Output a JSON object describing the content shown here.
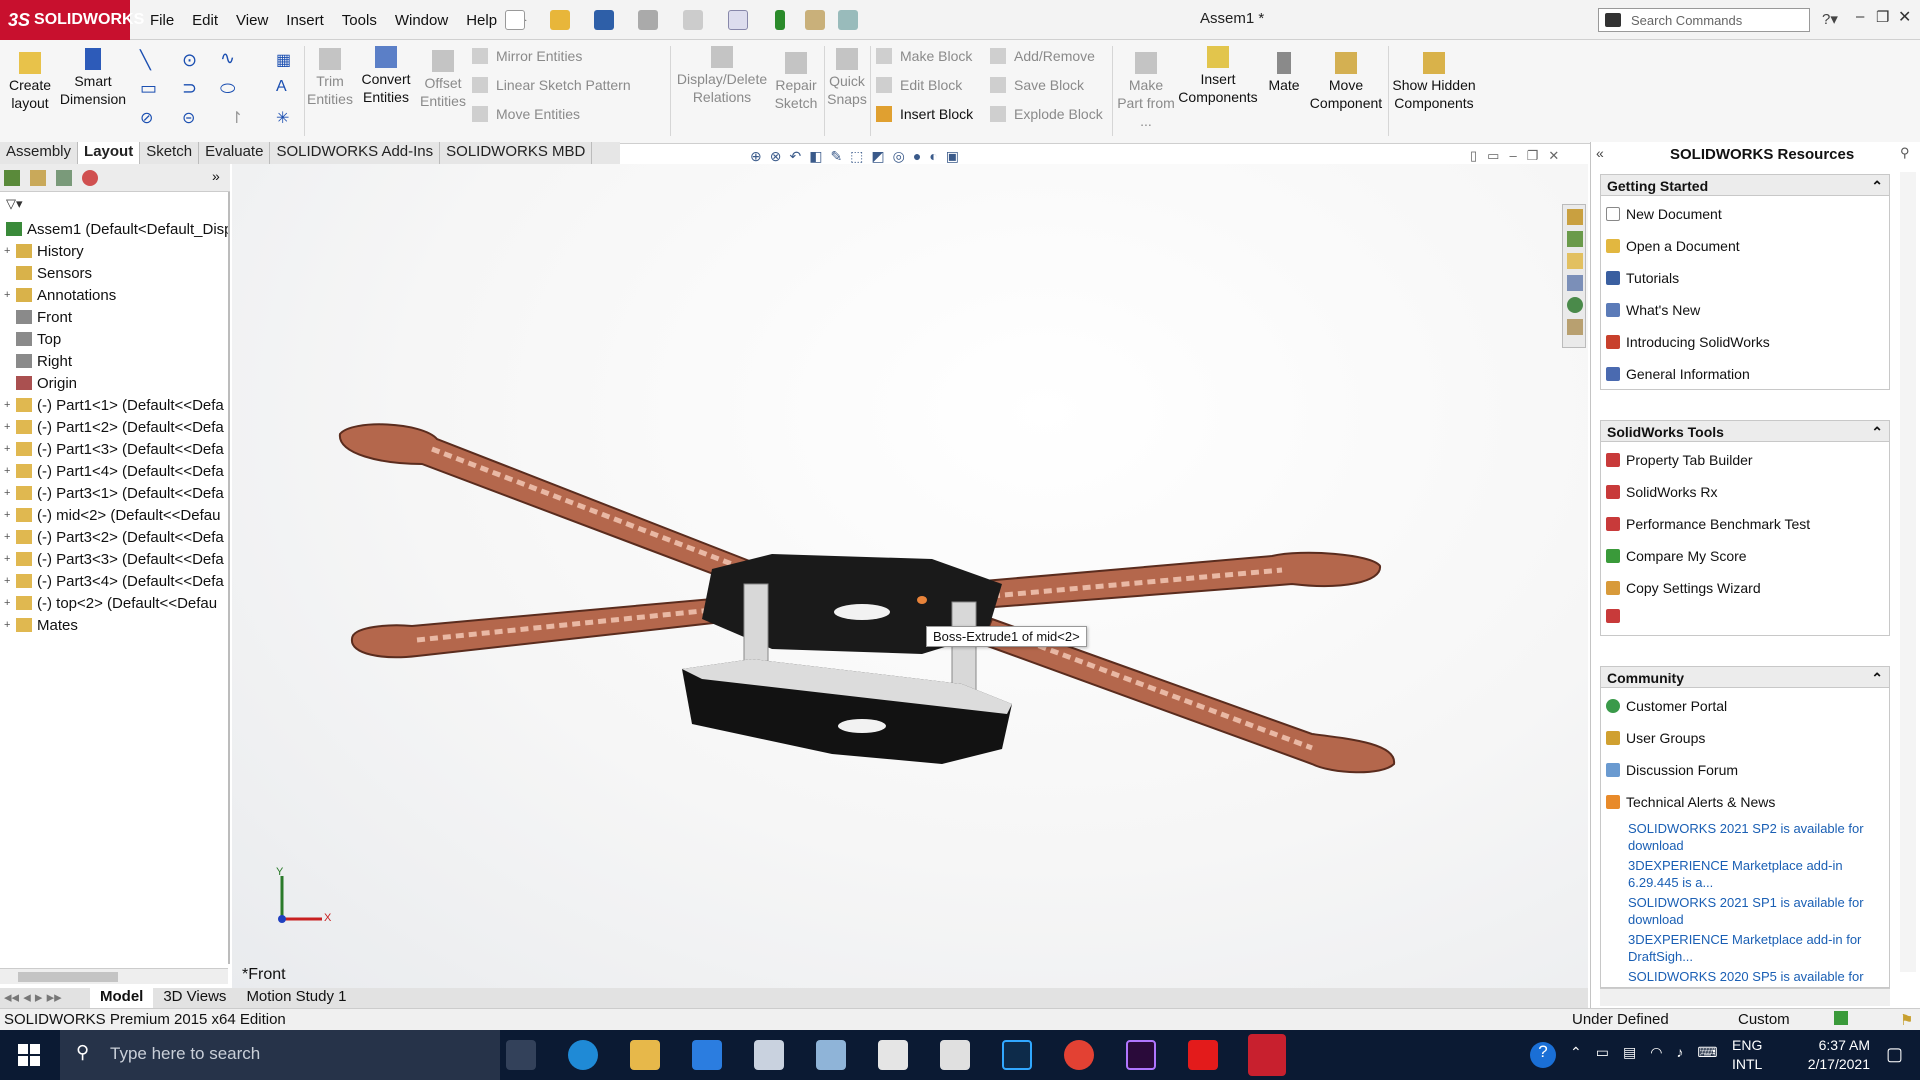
{
  "app": {
    "brand": "SOLIDWORKS",
    "doc_title": "Assem1 *"
  },
  "menu": [
    "File",
    "Edit",
    "View",
    "Insert",
    "Tools",
    "Window",
    "Help"
  ],
  "search": {
    "placeholder": "Search Commands"
  },
  "ribbon": {
    "create_layout": "Create layout",
    "smart_dimension": "Smart Dimension",
    "trim_entities": "Trim Entities",
    "convert_entities": "Convert Entities",
    "offset_entities": "Offset Entities",
    "mirror_entities": "Mirror Entities",
    "linear_sketch_pattern": "Linear Sketch Pattern",
    "move_entities": "Move Entities",
    "display_delete_relations": "Display/Delete Relations",
    "repair_sketch": "Repair Sketch",
    "quick_snaps": "Quick Snaps",
    "make_block": "Make Block",
    "edit_block": "Edit Block",
    "insert_block": "Insert Block",
    "add_remove": "Add/Remove",
    "save_block": "Save Block",
    "explode_block": "Explode Block",
    "make_part_from": "Make Part from ...",
    "insert_components": "Insert Components",
    "mate": "Mate",
    "move_component": "Move Component",
    "show_hidden_components": "Show Hidden Components"
  },
  "tabs": [
    "Assembly",
    "Layout",
    "Sketch",
    "Evaluate",
    "SOLIDWORKS Add-Ins",
    "SOLIDWORKS MBD"
  ],
  "tree": [
    {
      "label": "Assem1  (Default<Default_Disp",
      "expand": ""
    },
    {
      "label": "History",
      "expand": "+"
    },
    {
      "label": "Sensors",
      "expand": ""
    },
    {
      "label": "Annotations",
      "expand": "+"
    },
    {
      "label": "Front",
      "expand": ""
    },
    {
      "label": "Top",
      "expand": ""
    },
    {
      "label": "Right",
      "expand": ""
    },
    {
      "label": "Origin",
      "expand": ""
    },
    {
      "label": "(-) Part1<1> (Default<<Defa",
      "expand": "+"
    },
    {
      "label": "(-) Part1<2> (Default<<Defa",
      "expand": "+"
    },
    {
      "label": "(-) Part1<3> (Default<<Defa",
      "expand": "+"
    },
    {
      "label": "(-) Part1<4> (Default<<Defa",
      "expand": "+"
    },
    {
      "label": "(-) Part3<1> (Default<<Defa",
      "expand": "+"
    },
    {
      "label": "(-) mid<2> (Default<<Defau",
      "expand": "+"
    },
    {
      "label": "(-) Part3<2> (Default<<Defa",
      "expand": "+"
    },
    {
      "label": "(-) Part3<3> (Default<<Defa",
      "expand": "+"
    },
    {
      "label": "(-) Part3<4> (Default<<Defa",
      "expand": "+"
    },
    {
      "label": "(-) top<2> (Default<<Defau",
      "expand": "+"
    },
    {
      "label": "Mates",
      "expand": "+"
    }
  ],
  "viewport": {
    "tooltip": "Boss-Extrude1 of mid<2>",
    "view_label": "*Front",
    "axis_x": "X",
    "axis_y": "Y"
  },
  "resources": {
    "title": "SOLIDWORKS Resources",
    "getting_started": {
      "title": "Getting Started",
      "items": [
        "New Document",
        "Open a Document",
        "Tutorials",
        "What's New",
        "Introducing SolidWorks",
        "General Information"
      ]
    },
    "tools": {
      "title": "SolidWorks Tools",
      "items": [
        "Property Tab Builder",
        "SolidWorks Rx",
        "Performance Benchmark Test",
        "Compare My Score",
        "Copy Settings Wizard"
      ]
    },
    "community": {
      "title": "Community",
      "items": [
        "Customer Portal",
        "User Groups",
        "Discussion Forum",
        "Technical Alerts & News"
      ]
    },
    "news": [
      "SOLIDWORKS 2021 SP2 is available for download",
      "3DEXPERIENCE Marketplace add-in 6.29.445 is a...",
      "SOLIDWORKS 2021 SP1 is available for download",
      "3DEXPERIENCE Marketplace add-in for DraftSigh...",
      "SOLIDWORKS 2020 SP5 is available for"
    ]
  },
  "bottom_tabs": [
    "Model",
    "3D Views",
    "Motion Study 1"
  ],
  "status": {
    "edition": "SOLIDWORKS Premium 2015 x64 Edition",
    "state": "Under Defined",
    "units": "Custom"
  },
  "taskbar": {
    "search_placeholder": "Type here to search",
    "lang1": "ENG",
    "lang2": "INTL",
    "time": "6:37 AM",
    "date": "2/17/2021"
  },
  "colors": {
    "brand_red": "#c8102e",
    "arm_copper": "#b56a4e",
    "link_blue": "#1a5fb4",
    "taskbar": "#0b1a33"
  }
}
